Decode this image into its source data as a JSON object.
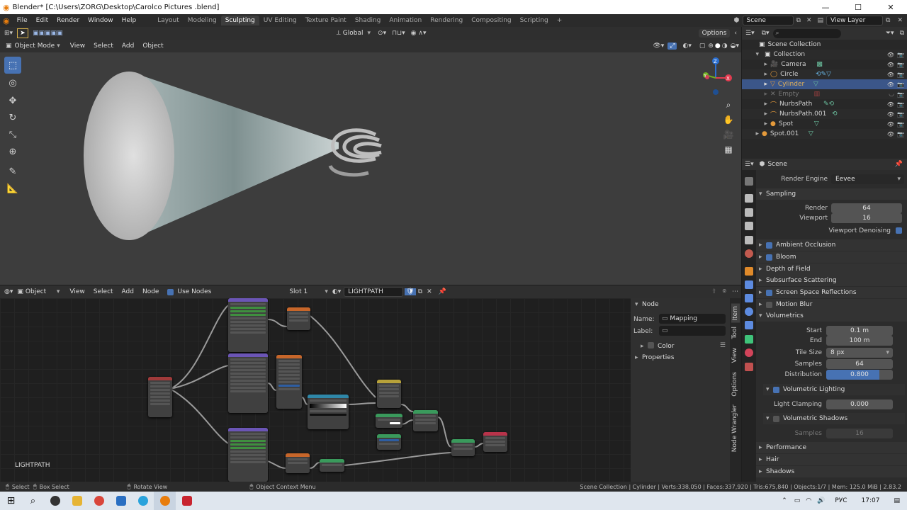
{
  "window": {
    "title": "Blender* [C:\\Users\\ZORG\\Desktop\\Carolco Pictures .blend]",
    "minimize": "—",
    "maximize": "☐",
    "close": "✕"
  },
  "menu": [
    "File",
    "Edit",
    "Render",
    "Window",
    "Help"
  ],
  "workspaces": [
    "Layout",
    "Modeling",
    "Sculpting",
    "UV Editing",
    "Texture Paint",
    "Shading",
    "Animation",
    "Rendering",
    "Compositing",
    "Scripting",
    "+"
  ],
  "active_workspace": "Sculpting",
  "scene": {
    "name": "Scene",
    "view_layer": "View Layer"
  },
  "viewport": {
    "transform_orientation": "Global",
    "options_label": "Options",
    "mode": "Object Mode",
    "menu": [
      "View",
      "Select",
      "Add",
      "Object"
    ],
    "gizmo_axes": {
      "x": "X",
      "y": "Y",
      "z": "Z"
    }
  },
  "node_editor": {
    "editor_type": "Object",
    "menu": [
      "View",
      "Select",
      "Add",
      "Node"
    ],
    "use_nodes_label": "Use Nodes",
    "slot": "Slot 1",
    "material": "LIGHTPATH",
    "overlay_label": "LIGHTPATH",
    "panel": {
      "section": "Node",
      "name_label": "Name:",
      "name_value": "Mapping",
      "label_label": "Label:",
      "label_value": "",
      "color_label": "Color",
      "properties_label": "Properties"
    },
    "tabs": [
      "Item",
      "Tool",
      "View",
      "Options",
      "Node Wrangler"
    ]
  },
  "outliner": {
    "root": "Scene Collection",
    "items": [
      {
        "name": "Collection",
        "level": 1
      },
      {
        "name": "Camera",
        "level": 2
      },
      {
        "name": "Circle",
        "level": 2
      },
      {
        "name": "Cylinder",
        "level": 2,
        "selected": true
      },
      {
        "name": "Empty",
        "level": 2,
        "dim": true
      },
      {
        "name": "NurbsPath",
        "level": 2
      },
      {
        "name": "NurbsPath.001",
        "level": 2
      },
      {
        "name": "Spot",
        "level": 2
      },
      {
        "name": "Spot.001",
        "level": 1
      }
    ]
  },
  "properties": {
    "context": "Scene",
    "render_engine_label": "Render Engine",
    "render_engine": "Eevee",
    "sampling": {
      "title": "Sampling",
      "render_label": "Render",
      "render": "64",
      "viewport_label": "Viewport",
      "viewport": "16",
      "denoise_label": "Viewport Denoising"
    },
    "panels": [
      {
        "label": "Ambient Occlusion",
        "checkbox": true
      },
      {
        "label": "Bloom",
        "checkbox": true
      },
      {
        "label": "Depth of Field",
        "checkbox": null
      },
      {
        "label": "Subsurface Scattering",
        "checkbox": null
      },
      {
        "label": "Screen Space Reflections",
        "checkbox": true
      },
      {
        "label": "Motion Blur",
        "checkbox": false
      },
      {
        "label": "Volumetrics",
        "checkbox": null
      }
    ],
    "volumetrics": {
      "start_label": "Start",
      "start": "0.1 m",
      "end_label": "End",
      "end": "100 m",
      "tile_size_label": "Tile Size",
      "tile_size": "8 px",
      "samples_label": "Samples",
      "samples": "64",
      "distribution_label": "Distribution",
      "distribution": "0.800",
      "distribution_fraction": 0.8,
      "lighting_label": "Volumetric Lighting",
      "clamp_label": "Light Clamping",
      "clamp": "0.000",
      "shadows_label": "Volumetric Shadows",
      "shadow_samples_label": "Samples",
      "shadow_samples": "16"
    },
    "more_panels": [
      "Performance",
      "Hair",
      "Shadows"
    ]
  },
  "status": {
    "select": "Select",
    "box_select": "Box Select",
    "rotate_view": "Rotate View",
    "context_menu": "Object Context Menu",
    "stats": "Scene Collection | Cylinder | Verts:338,050 | Faces:337,920 | Tris:675,840 | Objects:1/7 | Mem: 125.0 MiB | 2.83.2"
  },
  "taskbar": {
    "language": "РУС",
    "time": "17:07"
  },
  "colors": {
    "accent": "#4772b3",
    "selection": "#3b5689",
    "viewport_bg": "#3d3d3d"
  }
}
